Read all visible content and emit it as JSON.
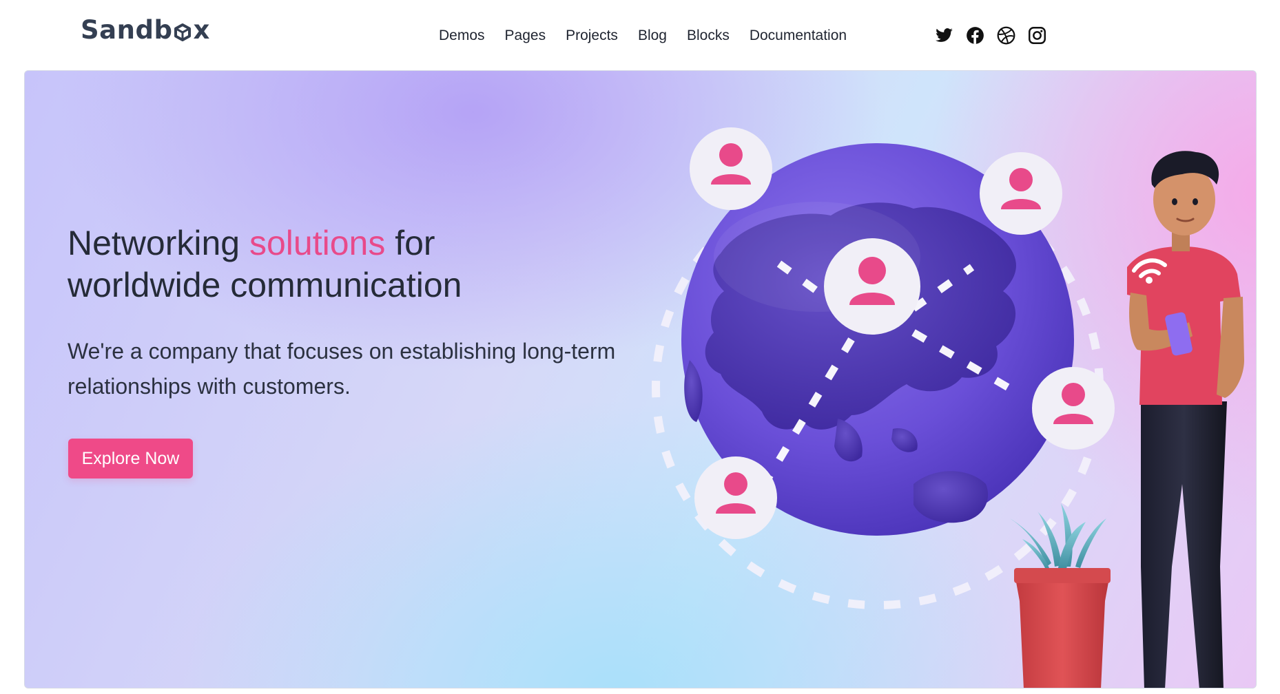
{
  "brand": {
    "name": "Sandbox",
    "name_prefix": "Sandb",
    "name_suffix": "x"
  },
  "nav": {
    "items": [
      {
        "label": "Demos"
      },
      {
        "label": "Pages"
      },
      {
        "label": "Projects"
      },
      {
        "label": "Blog"
      },
      {
        "label": "Blocks"
      },
      {
        "label": "Documentation"
      }
    ]
  },
  "social": {
    "icons": [
      "twitter-icon",
      "facebook-icon",
      "dribbble-icon",
      "instagram-icon"
    ]
  },
  "hero": {
    "title_part1": "Networking ",
    "title_accent": "solutions",
    "title_part2": " for",
    "title_line2": "worldwide communication",
    "lead": "We're a company that focuses on establishing long-term relationships with customers.",
    "cta_label": "Explore Now"
  },
  "colors": {
    "accent": "#ef4a88",
    "heading": "#252b38",
    "globe": "#6a4fd8",
    "logo": "#343f52"
  }
}
